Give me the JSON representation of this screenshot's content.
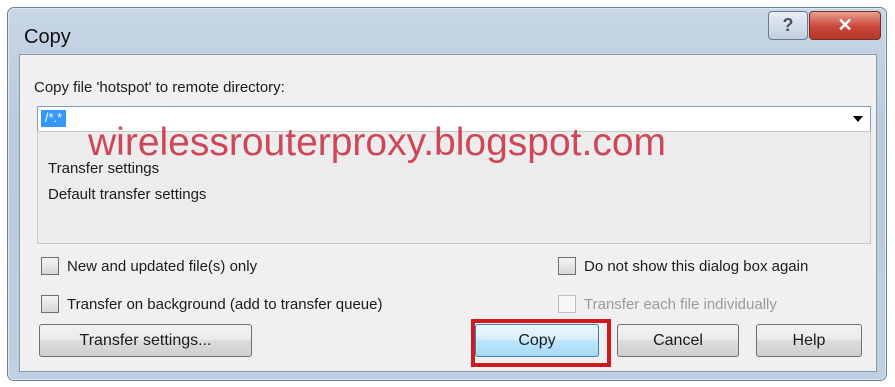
{
  "window": {
    "title": "Copy",
    "help_glyph": "?",
    "close_glyph": "✕"
  },
  "prompt": "Copy file 'hotspot' to remote directory:",
  "combo": {
    "value": "/*.*"
  },
  "settings": {
    "line1": "Transfer settings",
    "line2": "Default transfer settings"
  },
  "watermark": "wirelessrouterproxy.blogspot.com",
  "options": {
    "new_updated": "New and updated file(s) only",
    "background": "Transfer on background (add to transfer queue)",
    "do_not_show": "Do not show this dialog box again",
    "each_file": "Transfer each file individually"
  },
  "buttons": {
    "transfer_settings": "Transfer settings...",
    "copy": "Copy",
    "cancel": "Cancel",
    "help": "Help"
  },
  "colors": {
    "highlight": "#d0191e",
    "watermark": "#c8243a",
    "selection": "#3399ff"
  }
}
